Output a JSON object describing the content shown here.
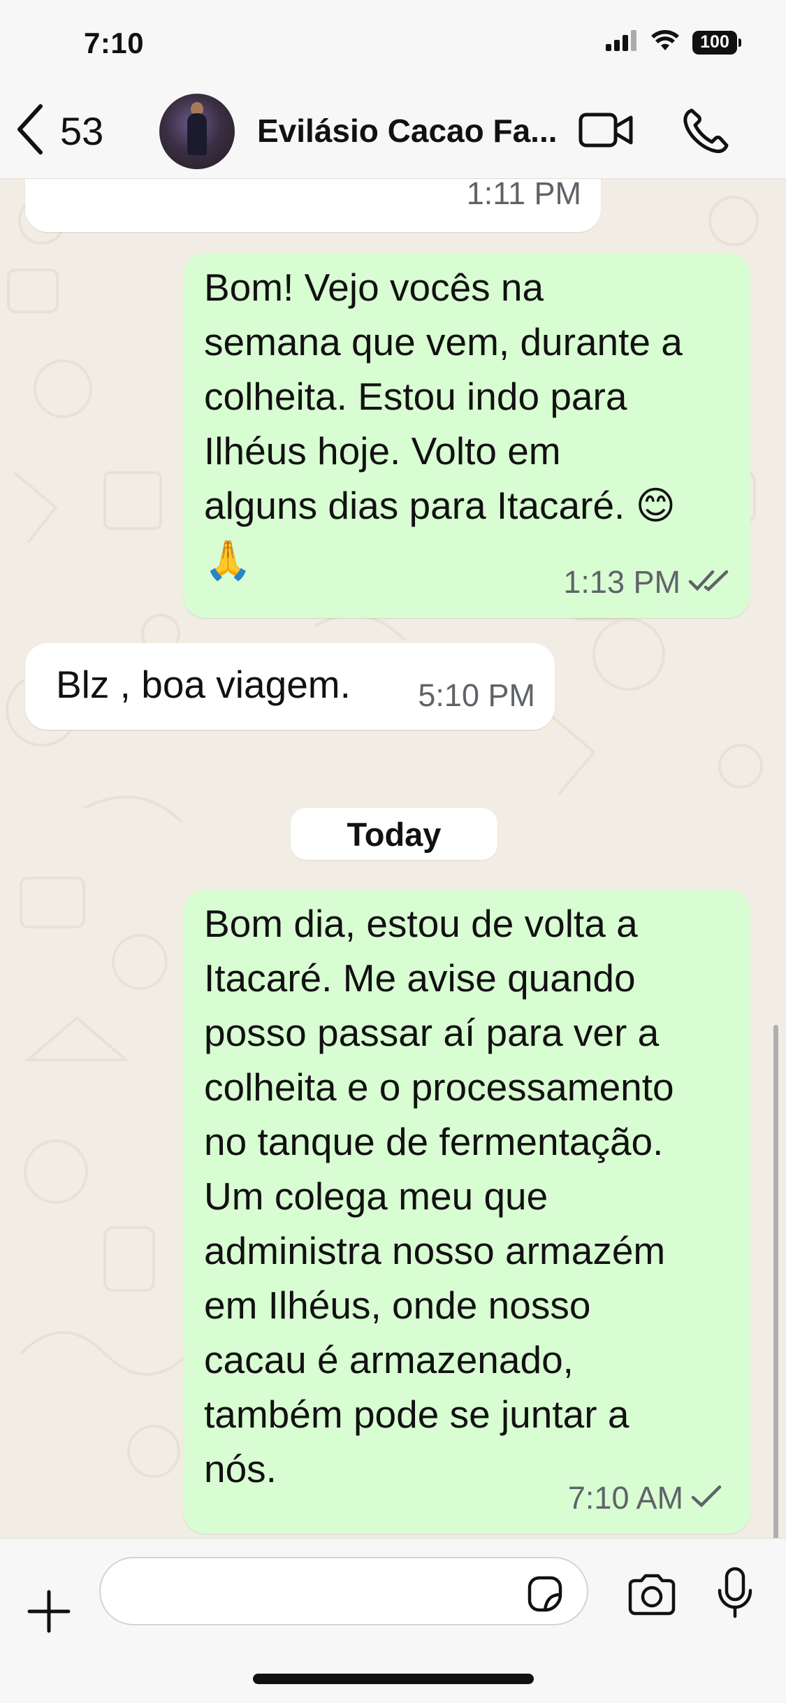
{
  "status_bar": {
    "time": "7:10",
    "battery": "100",
    "icons": [
      "signal-icon",
      "wifi-icon",
      "battery-icon"
    ]
  },
  "header": {
    "back_count": "53",
    "contact_name": "Evilásio Cacao Fa...",
    "icons": [
      "back-chevron-icon",
      "video-call-icon",
      "voice-call-icon"
    ]
  },
  "messages": [
    {
      "direction": "incoming",
      "text": "",
      "time": "1:11 PM",
      "status": ""
    },
    {
      "direction": "outgoing",
      "text": "Bom! Vejo vocês na\nsemana que vem, durante a\ncolheita. Estou indo para\nIlhéus hoje. Volto em\nalguns dias para Itacaré. 😊\n🙏",
      "time": "1:13 PM",
      "status": "read"
    },
    {
      "direction": "incoming",
      "text": "Blz , boa viagem.",
      "time": "5:10 PM",
      "status": ""
    },
    {
      "direction": "outgoing",
      "text": "Bom dia, estou de volta a\nItacaré. Me avise quando\nposso passar aí para ver a\ncolheita e o processamento\nno tanque de fermentação.\nUm colega meu que\nadministra nosso armazém\nem Ilhéus, onde nosso\ncacau é armazenado,\ntambém pode se juntar a\nnós.",
      "time": "7:10 AM",
      "status": "sent"
    }
  ],
  "date_separator": "Today",
  "composer": {
    "placeholder": "",
    "value": "",
    "icons": [
      "plus-icon",
      "sticker-icon",
      "camera-icon",
      "microphone-icon"
    ]
  },
  "colors": {
    "outgoing_bubble": "#d9fdd3",
    "incoming_bubble": "#ffffff",
    "chat_background": "#f1ede5",
    "read_tick": "#5f6368"
  }
}
